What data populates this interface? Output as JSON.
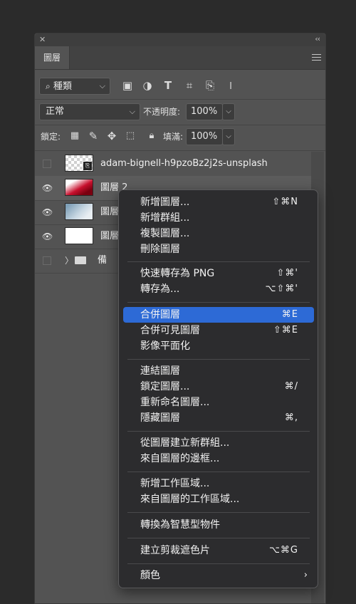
{
  "panel": {
    "tab_label": "圖層",
    "filter_label": "種類",
    "blend_mode": "正常",
    "opacity_label": "不透明度:",
    "opacity_value": "100%",
    "lock_label": "鎖定:",
    "fill_label": "填滿:",
    "fill_value": "100%"
  },
  "layers": [
    {
      "name": "adam-bignell-h9pzoBz2j2s-unsplash",
      "visible": false
    },
    {
      "name": "圖層 2",
      "visible": true
    },
    {
      "name": "圖層",
      "visible": true
    },
    {
      "name": "圖層",
      "visible": true
    },
    {
      "name": "備",
      "visible": false
    }
  ],
  "menu": {
    "new_layer": "新增圖層...",
    "new_layer_key": "⇧⌘N",
    "new_group": "新增群組...",
    "duplicate_layer": "複製圖層...",
    "delete_layer": "刪除圖層",
    "quick_export": "快速轉存為 PNG",
    "quick_export_key": "⇧⌘'",
    "export_as": "轉存為...",
    "export_as_key": "⌥⇧⌘'",
    "merge_layers": "合併圖層",
    "merge_layers_key": "⌘E",
    "merge_visible": "合併可見圖層",
    "merge_visible_key": "⇧⌘E",
    "flatten": "影像平面化",
    "link_layers": "連結圖層",
    "lock_layers": "鎖定圖層...",
    "lock_layers_key": "⌘/",
    "rename_layer": "重新命名圖層...",
    "hide_layers": "隱藏圖層",
    "hide_layers_key": "⌘,",
    "group_from_layers": "從圖層建立新群組...",
    "frame_from_layers": "來自圖層的邊框...",
    "new_artboard": "新增工作區域...",
    "artboard_from_layers": "來自圖層的工作區域...",
    "convert_smart_object": "轉換為智慧型物件",
    "clipping_mask": "建立剪裁遮色片",
    "clipping_mask_key": "⌥⌘G",
    "color": "顏色"
  },
  "colors": {
    "highlight": "#2d6ad6",
    "panel_bg": "#535353",
    "menu_bg": "#2c2c2e"
  }
}
